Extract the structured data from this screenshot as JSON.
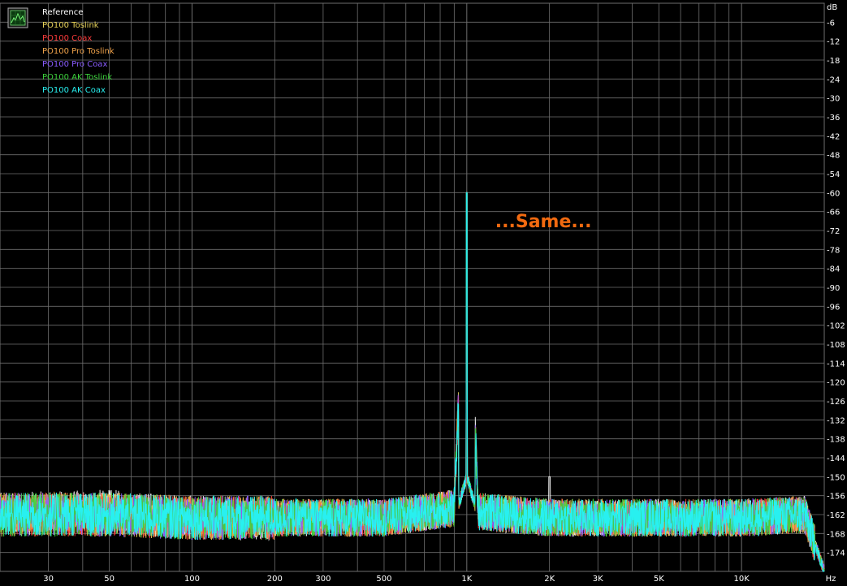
{
  "chart_data": {
    "type": "line",
    "title": "",
    "xlabel": "",
    "ylabel": "",
    "x_unit": "Hz",
    "y_unit": "dB",
    "xscale": "log",
    "xlim": [
      20,
      20000
    ],
    "ylim": [
      -180,
      0
    ],
    "x_tick_labels": [
      {
        "v": 30,
        "label": "30"
      },
      {
        "v": 50,
        "label": "50"
      },
      {
        "v": 100,
        "label": "100"
      },
      {
        "v": 200,
        "label": "200"
      },
      {
        "v": 300,
        "label": "300"
      },
      {
        "v": 500,
        "label": "500"
      },
      {
        "v": 1000,
        "label": "1K"
      },
      {
        "v": 2000,
        "label": "2K"
      },
      {
        "v": 3000,
        "label": "3K"
      },
      {
        "v": 5000,
        "label": "5K"
      },
      {
        "v": 10000,
        "label": "10K"
      }
    ],
    "y_ticks": [
      -6,
      -12,
      -18,
      -24,
      -30,
      -36,
      -42,
      -48,
      -54,
      -60,
      -66,
      -72,
      -78,
      -84,
      -90,
      -96,
      -102,
      -108,
      -114,
      -120,
      -126,
      -132,
      -138,
      -144,
      -150,
      -156,
      -162,
      -168,
      -174
    ],
    "grid": true,
    "legend_position": "top-left",
    "background": "#000000",
    "grid_color": "#6e6e6e",
    "series": [
      {
        "name": "Reference",
        "color": "#ffffff",
        "points": [
          [
            20,
            -162
          ],
          [
            50,
            -161
          ],
          [
            100,
            -163
          ],
          [
            200,
            -163
          ],
          [
            500,
            -163
          ],
          [
            900,
            -160
          ],
          [
            1000,
            -60
          ],
          [
            1100,
            -161
          ],
          [
            2000,
            -163
          ],
          [
            5000,
            -163
          ],
          [
            10000,
            -163
          ],
          [
            17000,
            -162
          ],
          [
            20000,
            -180
          ]
        ]
      },
      {
        "name": "PO100 Toslink",
        "color": "#e8d35a",
        "points": [
          [
            20,
            -162
          ],
          [
            50,
            -162
          ],
          [
            100,
            -163
          ],
          [
            200,
            -163
          ],
          [
            500,
            -163
          ],
          [
            900,
            -160
          ],
          [
            1000,
            -60
          ],
          [
            1100,
            -161
          ],
          [
            2000,
            -163
          ],
          [
            5000,
            -163
          ],
          [
            10000,
            -163
          ],
          [
            17000,
            -162
          ],
          [
            20000,
            -180
          ]
        ]
      },
      {
        "name": "PO100 Coax",
        "color": "#ff3b3b",
        "points": [
          [
            20,
            -162
          ],
          [
            50,
            -162
          ],
          [
            100,
            -163
          ],
          [
            200,
            -163
          ],
          [
            500,
            -163
          ],
          [
            900,
            -160
          ],
          [
            1000,
            -60
          ],
          [
            1100,
            -161
          ],
          [
            2000,
            -163
          ],
          [
            5000,
            -163
          ],
          [
            10000,
            -163
          ],
          [
            17000,
            -162
          ],
          [
            20000,
            -180
          ]
        ]
      },
      {
        "name": "PO100 Pro Toslink",
        "color": "#f0a24a",
        "points": [
          [
            20,
            -162
          ],
          [
            50,
            -162
          ],
          [
            100,
            -163
          ],
          [
            200,
            -163
          ],
          [
            500,
            -163
          ],
          [
            900,
            -160
          ],
          [
            1000,
            -60
          ],
          [
            1100,
            -161
          ],
          [
            2000,
            -163
          ],
          [
            5000,
            -163
          ],
          [
            10000,
            -163
          ],
          [
            17000,
            -162
          ],
          [
            20000,
            -180
          ]
        ]
      },
      {
        "name": "PO100 Pro Coax",
        "color": "#8a5cff",
        "points": [
          [
            20,
            -162
          ],
          [
            50,
            -162
          ],
          [
            100,
            -163
          ],
          [
            200,
            -163
          ],
          [
            500,
            -163
          ],
          [
            900,
            -160
          ],
          [
            1000,
            -60
          ],
          [
            1100,
            -161
          ],
          [
            2000,
            -163
          ],
          [
            5000,
            -163
          ],
          [
            10000,
            -163
          ],
          [
            17000,
            -162
          ],
          [
            20000,
            -180
          ]
        ]
      },
      {
        "name": "PO100 AK Toslink",
        "color": "#3cd23c",
        "points": [
          [
            20,
            -162
          ],
          [
            50,
            -162
          ],
          [
            100,
            -163
          ],
          [
            200,
            -163
          ],
          [
            500,
            -163
          ],
          [
            900,
            -160
          ],
          [
            1000,
            -60
          ],
          [
            1100,
            -161
          ],
          [
            2000,
            -163
          ],
          [
            5000,
            -163
          ],
          [
            10000,
            -163
          ],
          [
            17000,
            -162
          ],
          [
            20000,
            -180
          ]
        ]
      },
      {
        "name": "PO100 AK Coax",
        "color": "#28f0f0",
        "points": [
          [
            20,
            -162
          ],
          [
            50,
            -162
          ],
          [
            100,
            -163
          ],
          [
            200,
            -163
          ],
          [
            500,
            -163
          ],
          [
            900,
            -160
          ],
          [
            1000,
            -60
          ],
          [
            1100,
            -161
          ],
          [
            2000,
            -163
          ],
          [
            5000,
            -163
          ],
          [
            10000,
            -163
          ],
          [
            17000,
            -162
          ],
          [
            20000,
            -180
          ]
        ]
      }
    ],
    "annotations": [
      {
        "text": "...Same...",
        "x": 1900,
        "y": -71,
        "color": "#f26a10"
      }
    ]
  },
  "icons": {
    "legend": "chart-icon"
  }
}
